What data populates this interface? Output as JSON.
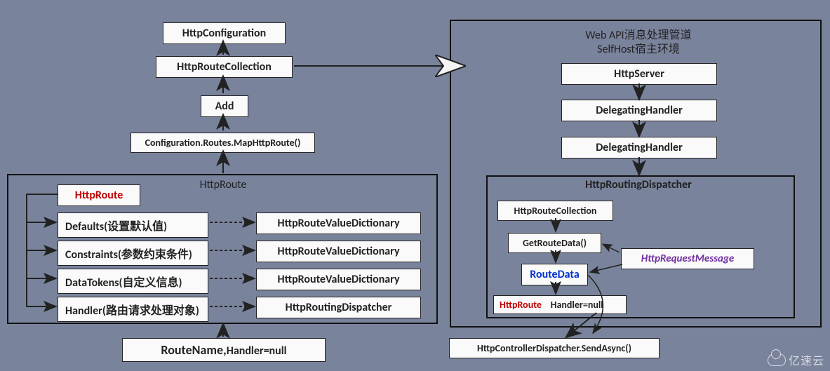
{
  "left": {
    "httpConfiguration": "HttpConfiguration",
    "httpRouteCollection": "HttpRouteCollection",
    "add": "Add",
    "mapHttpRoute": "Configuration.Routes.MapHttpRoute()",
    "httpRouteGroupLabel": "HttpRoute",
    "httpRoute": "HttpRoute",
    "defaults": "Defaults(设置默认值)",
    "constraints": "Constraints(参数约束条件)",
    "dataTokens": "DataTokens(自定义信息)",
    "handler": "Handler(路由请求处理对象)",
    "dict1": "HttpRouteValueDictionary",
    "dict2": "HttpRouteValueDictionary",
    "dict3": "HttpRouteValueDictionary",
    "routingDispatcher": "HttpRoutingDispatcher",
    "routeNameHandler_a": "RouteName,",
    "routeNameHandler_b": "Handler=null"
  },
  "right": {
    "title1": "Web API消息处理管道",
    "title2": "SelfHost宿主环境",
    "httpServer": "HttpServer",
    "delegatingHandler1": "DelegatingHandler",
    "delegatingHandler2": "DelegatingHandler",
    "dispatcherGroup": "HttpRoutingDispatcher",
    "httpRouteCollection": "HttpRouteCollection",
    "getRouteData": "GetRouteData()",
    "routeData": "RouteData",
    "httpRequestMessage": "HttpRequestMessage",
    "httpRoute": "HttpRoute",
    "handlerNull": "Handler=null",
    "sendAsync": "HttpControllerDispatcher.SendAsync()"
  },
  "watermark": "亿速云"
}
